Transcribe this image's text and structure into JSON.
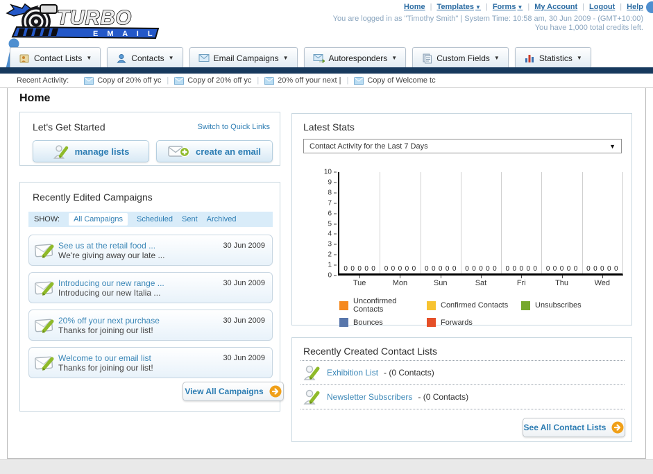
{
  "header": {
    "logo_line1": "TURBO",
    "logo_line2": "E M A I L",
    "nav_links": [
      {
        "label": "Home",
        "dropdown": false
      },
      {
        "label": "Templates",
        "dropdown": true
      },
      {
        "label": "Forms",
        "dropdown": true
      },
      {
        "label": "My Account",
        "dropdown": false
      },
      {
        "label": "Logout",
        "dropdown": false
      },
      {
        "label": "Help",
        "dropdown": false
      }
    ],
    "login_info": "You are logged in as \"Timothy Smith\" | System Time: 10:58 am, 30 Jun 2009 - (GMT+10:00)",
    "credits_info": "You have 1,000 total credits left."
  },
  "tabs": [
    {
      "label": "Contact Lists"
    },
    {
      "label": "Contacts"
    },
    {
      "label": "Email Campaigns"
    },
    {
      "label": "Autoresponders"
    },
    {
      "label": "Custom Fields"
    },
    {
      "label": "Statistics"
    }
  ],
  "recent_activity": {
    "label": "Recent Activity:",
    "items": [
      {
        "text": "Copy of 20% off yc"
      },
      {
        "text": "Copy of 20% off yc"
      },
      {
        "text": "20% off your next |"
      },
      {
        "text": "Copy of Welcome tc"
      }
    ]
  },
  "page_title": "Home",
  "get_started": {
    "title": "Let's Get Started",
    "switch_link": "Switch to Quick Links",
    "manage_lists_label": "manage lists",
    "create_email_label": "create an email"
  },
  "campaigns": {
    "title": "Recently Edited Campaigns",
    "show_label": "SHOW:",
    "filters": [
      {
        "label": "All Campaigns",
        "active": true
      },
      {
        "label": "Scheduled",
        "active": false
      },
      {
        "label": "Sent",
        "active": false
      },
      {
        "label": "Archived",
        "active": false
      }
    ],
    "items": [
      {
        "title": "See us at the retail food ...",
        "subtitle": "We're giving away our late ...",
        "date": "30 Jun 2009"
      },
      {
        "title": "Introducing our new range ...",
        "subtitle": "Introducing our new Italia ...",
        "date": "30 Jun 2009"
      },
      {
        "title": "20% off your next purchase",
        "subtitle": "Thanks for joining our list!",
        "date": "30 Jun 2009"
      },
      {
        "title": "Welcome to our email list",
        "subtitle": "Thanks for joining our list!",
        "date": "30 Jun 2009"
      }
    ],
    "view_all_label": "View All Campaigns"
  },
  "latest_stats": {
    "title": "Latest Stats",
    "dropdown_value": "Contact Activity for the Last 7 Days"
  },
  "chart_data": {
    "type": "bar",
    "title": "Contact Activity for the Last 7 Days",
    "categories": [
      "Tue",
      "Mon",
      "Sun",
      "Sat",
      "Fri",
      "Thu",
      "Wed"
    ],
    "series": [
      {
        "name": "Unconfirmed Contacts",
        "color": "#f5891f",
        "values": [
          0,
          0,
          0,
          0,
          0,
          0,
          0
        ]
      },
      {
        "name": "Confirmed Contacts",
        "color": "#f7c331",
        "values": [
          0,
          0,
          0,
          0,
          0,
          0,
          0
        ]
      },
      {
        "name": "Unsubscribes",
        "color": "#76a82d",
        "values": [
          0,
          0,
          0,
          0,
          0,
          0,
          0
        ]
      },
      {
        "name": "Bounces",
        "color": "#5876ab",
        "values": [
          0,
          0,
          0,
          0,
          0,
          0,
          0
        ]
      },
      {
        "name": "Forwards",
        "color": "#e54f28",
        "values": [
          0,
          0,
          0,
          0,
          0,
          0,
          0
        ]
      }
    ],
    "ylim": [
      0,
      10
    ],
    "ytick_step": 1,
    "grid": "vertical",
    "legend_position": "bottom",
    "value_labels": "each series value (0) printed at baseline per category"
  },
  "contact_lists": {
    "title": "Recently Created Contact Lists",
    "items": [
      {
        "name": "Exhibition List",
        "count": "- (0 Contacts)"
      },
      {
        "name": "Newsletter Subscribers",
        "count": "- (0 Contacts)"
      }
    ],
    "see_all_label": "See All Contact Lists"
  },
  "colors": {
    "navy_bar": "#17395d",
    "link_blue": "#2d7db3",
    "brand_blue": "#2458c8",
    "arrow_orange": "#f0a019"
  }
}
